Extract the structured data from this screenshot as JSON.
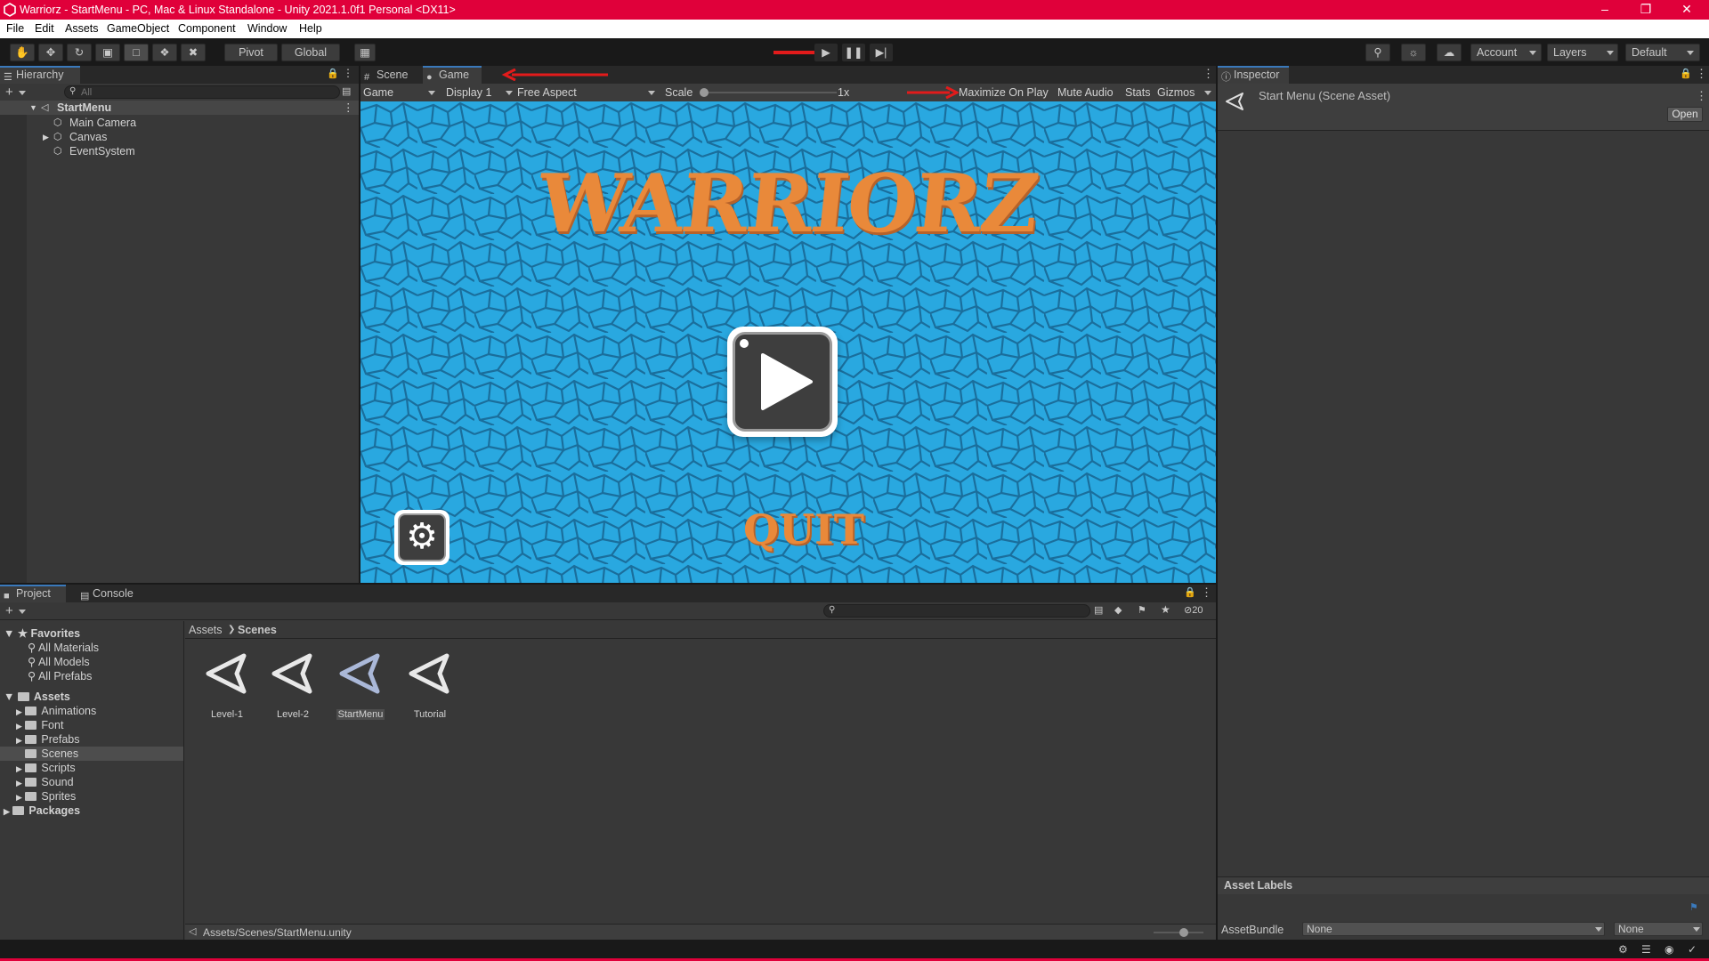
{
  "title_bar": {
    "title": "Warriorz - StartMenu - PC, Mac & Linux Standalone - Unity 2021.1.0f1 Personal <DX11>"
  },
  "menu": [
    "File",
    "Edit",
    "Assets",
    "GameObject",
    "Component",
    "Window",
    "Help"
  ],
  "toolbar": {
    "pivot": "Pivot",
    "global": "Global",
    "account": "Account",
    "layers": "Layers",
    "layout": "Default"
  },
  "hierarchy": {
    "tab": "Hierarchy",
    "search_placeholder": "All",
    "scene": "StartMenu",
    "items": [
      "Main Camera",
      "Canvas",
      "EventSystem"
    ]
  },
  "game_view": {
    "tabs": [
      "Scene",
      "Game"
    ],
    "mode": "Game",
    "display": "Display 1",
    "aspect": "Free Aspect",
    "scale_label": "Scale",
    "scale_value": "1x",
    "maximize": "Maximize On Play",
    "mute": "Mute Audio",
    "stats": "Stats",
    "gizmos": "Gizmos",
    "game_title": "WARRIORZ",
    "quit": "QUIT"
  },
  "inspector": {
    "tab": "Inspector",
    "asset_title": "Start Menu (Scene Asset)",
    "open": "Open",
    "asset_labels": "Asset Labels",
    "assetbundle_label": "AssetBundle",
    "assetbundle_value": "None",
    "variant_value": "None"
  },
  "project": {
    "tabs": [
      "Project",
      "Console"
    ],
    "hidden_count": "20",
    "favorites_label": "Favorites",
    "favorites": [
      "All Materials",
      "All Models",
      "All Prefabs"
    ],
    "assets_label": "Assets",
    "folders": [
      "Animations",
      "Font",
      "Prefabs",
      "Scenes",
      "Scripts",
      "Sound",
      "Sprites"
    ],
    "packages_label": "Packages",
    "breadcrumb": [
      "Assets",
      "Scenes"
    ],
    "scenes": [
      "Level-1",
      "Level-2",
      "StartMenu",
      "Tutorial"
    ],
    "path": "Assets/Scenes/StartMenu.unity"
  },
  "colors": {
    "title_bar": "#e0003a",
    "accent": "#3a79bb",
    "game_bg": "#29a8e0",
    "logo_orange": "#e9893a",
    "annotation_arrow": "#e21b1b"
  }
}
